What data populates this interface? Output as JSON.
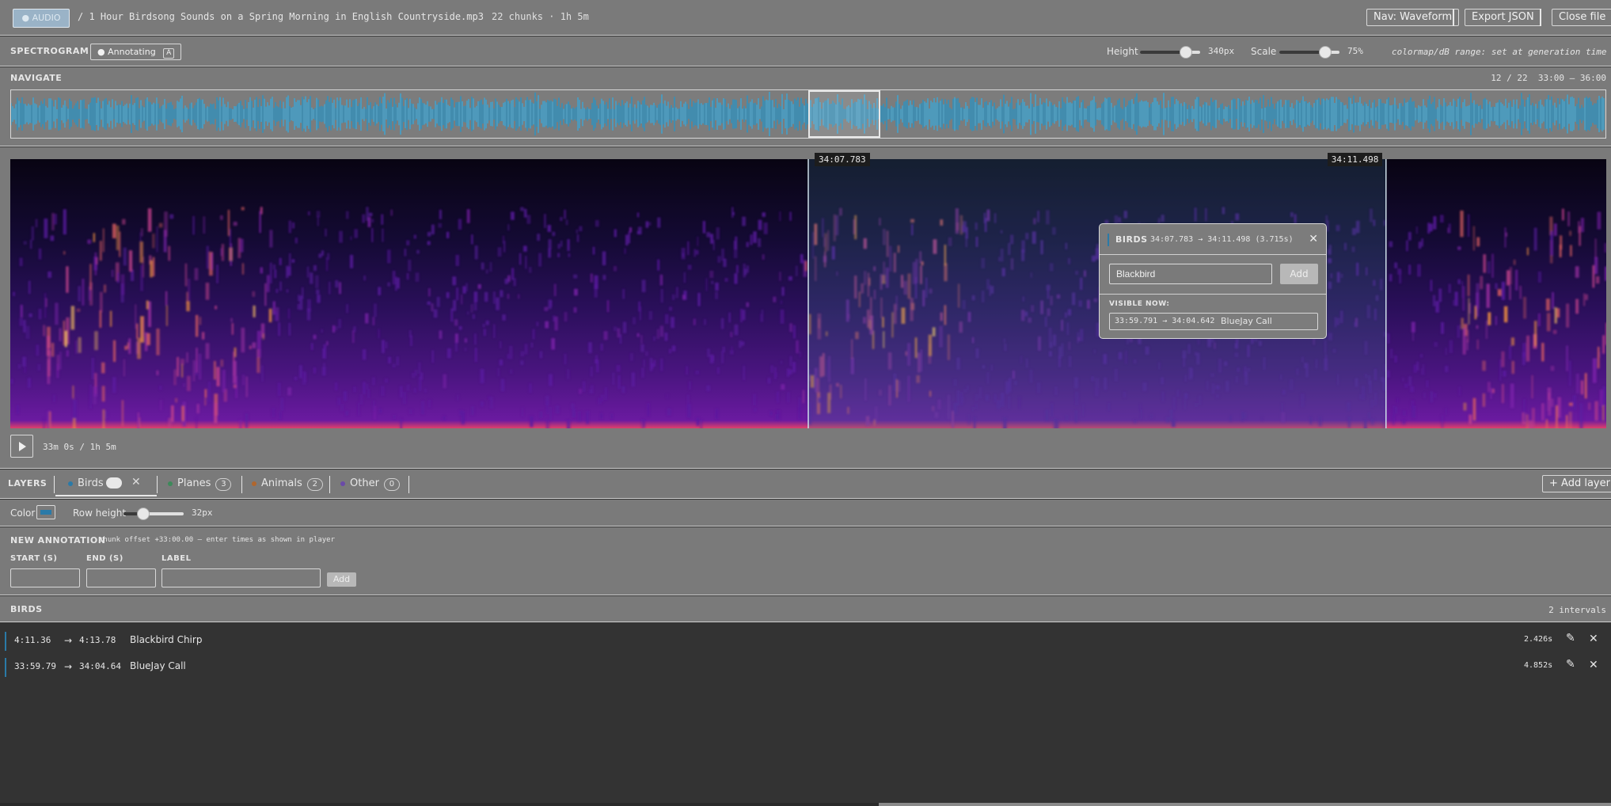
{
  "header": {
    "audio_badge": "● AUDIO",
    "file_name": "/ 1 Hour Birdsong Sounds on a Spring Morning in English Countryside.mp3",
    "meta": "22 chunks · 1h 5m",
    "nav_button": "Nav: Waveform",
    "export_button": "Export JSON",
    "close_button": "Close file"
  },
  "spectrogram_bar": {
    "title": "SPECTROGRAM",
    "mode_label": "● Annotating",
    "mode_key": "A",
    "height_label": "Height",
    "height_value": "340px",
    "height_level": 0.75,
    "scale_label": "Scale",
    "scale_value": "75%",
    "scale_level": 0.75,
    "colormap_note": "colormap/dB range: set at generation time"
  },
  "navigate": {
    "title": "NAVIGATE",
    "position": "12 / 22  33:00 – 36:00",
    "viewport_start": 0.5,
    "viewport_end": 0.545
  },
  "spectrogram": {
    "selection_start": "34:07.783",
    "selection_end": "34:11.498",
    "selection_from_frac": 0.5,
    "selection_to_frac": 0.862
  },
  "popup": {
    "layer": "BIRDS",
    "range": "34:07.783 → 34:11.498 (3.715s)",
    "input_value": "Blackbird",
    "add_button": "Add",
    "visible_title": "VISIBLE NOW:",
    "visible_item_time": "33:59.791 → 34:04.642",
    "visible_item_label": "BlueJay Call"
  },
  "player": {
    "time": "33m 0s / 1h 5m"
  },
  "layers": {
    "title": "LAYERS",
    "tabs": [
      {
        "name": "Birds",
        "color": "#2a7aa8"
      },
      {
        "name": "Planes",
        "count": "3",
        "color": "#3d8a5a"
      },
      {
        "name": "Animals",
        "count": "2",
        "color": "#b0662e"
      },
      {
        "name": "Other",
        "count": "0",
        "color": "#6a4aa8"
      }
    ],
    "add_layer": "+ Add layer"
  },
  "settings": {
    "color_label": "Color",
    "color_value": "#2a7aa8",
    "row_height_label": "Row height",
    "row_height_value": "32px",
    "row_height_level": 0.32
  },
  "new_annotation": {
    "title": "NEW ANNOTATION",
    "hint": "chunk offset +33:00.00 — enter times as shown in player",
    "start_label": "START (S)",
    "end_label": "END (S)",
    "label_label": "LABEL",
    "add_button": "Add"
  },
  "birds_list": {
    "title": "BIRDS",
    "count": "2 intervals",
    "rows": [
      {
        "start": "4:11.36",
        "arrow": "→",
        "end": "4:13.78",
        "label": "Blackbird Chirp",
        "duration": "2.426s"
      },
      {
        "start": "33:59.79",
        "arrow": "→",
        "end": "34:04.64",
        "label": "BlueJay Call",
        "duration": "4.852s"
      }
    ]
  }
}
